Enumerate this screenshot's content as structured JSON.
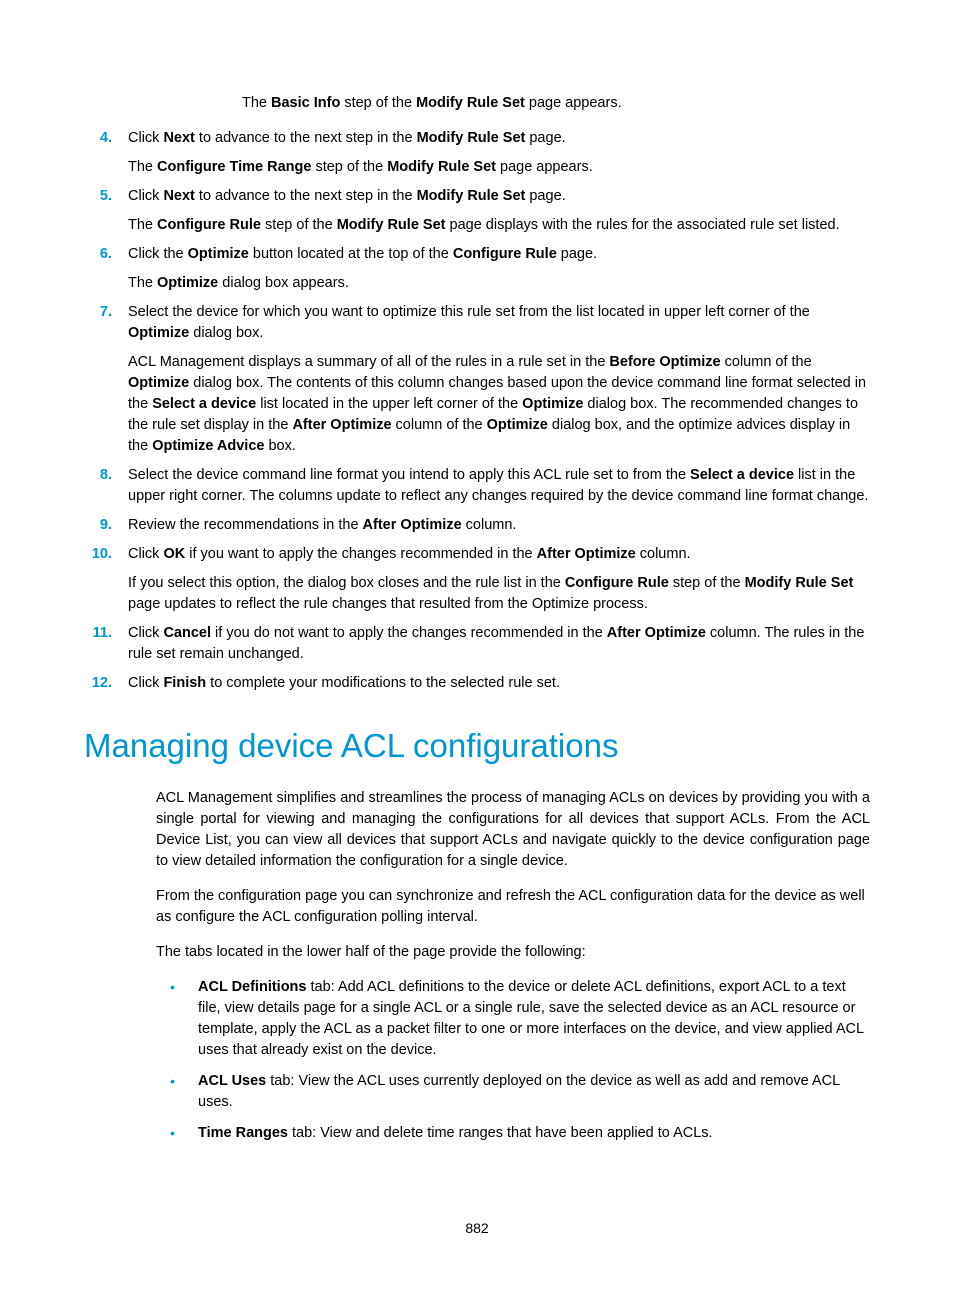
{
  "steps": {
    "s4pre": [
      {
        "t": "The "
      },
      {
        "t": "Basic Info",
        "b": true
      },
      {
        "t": " step of the "
      },
      {
        "t": "Modify Rule Set",
        "b": true
      },
      {
        "t": " page appears."
      }
    ],
    "s4_num": "4.",
    "s4_a": [
      {
        "t": "Click "
      },
      {
        "t": "Next",
        "b": true
      },
      {
        "t": " to advance to the next step in the "
      },
      {
        "t": "Modify Rule Set",
        "b": true
      },
      {
        "t": " page."
      }
    ],
    "s4_b": [
      {
        "t": "The "
      },
      {
        "t": "Configure Time Range",
        "b": true
      },
      {
        "t": " step of the "
      },
      {
        "t": "Modify Rule Set",
        "b": true
      },
      {
        "t": " page appears."
      }
    ],
    "s5_num": "5.",
    "s5_a": [
      {
        "t": "Click "
      },
      {
        "t": "Next",
        "b": true
      },
      {
        "t": " to advance to the next step in the "
      },
      {
        "t": "Modify Rule Set",
        "b": true
      },
      {
        "t": " page."
      }
    ],
    "s5_b": [
      {
        "t": "The "
      },
      {
        "t": "Configure Rule",
        "b": true
      },
      {
        "t": " step of the "
      },
      {
        "t": "Modify Rule Set",
        "b": true
      },
      {
        "t": " page displays with the rules for the associated rule set listed."
      }
    ],
    "s6_num": "6.",
    "s6_a": [
      {
        "t": "Click the "
      },
      {
        "t": "Optimize",
        "b": true
      },
      {
        "t": " button located at the top of the "
      },
      {
        "t": "Configure Rule",
        "b": true
      },
      {
        "t": " page."
      }
    ],
    "s6_b": [
      {
        "t": "The "
      },
      {
        "t": "Optimize",
        "b": true
      },
      {
        "t": " dialog box appears."
      }
    ],
    "s7_num": "7.",
    "s7_a": [
      {
        "t": "Select the device for which you want to optimize this rule set from the list located in upper left corner of the "
      },
      {
        "t": "Optimize",
        "b": true
      },
      {
        "t": " dialog box."
      }
    ],
    "s7_b": [
      {
        "t": "ACL Management displays a summary of all of the rules in a rule set in the "
      },
      {
        "t": "Before Optimize",
        "b": true
      },
      {
        "t": " column of the "
      },
      {
        "t": "Optimize",
        "b": true
      },
      {
        "t": " dialog box. The contents of this column changes based upon the device command line format selected in the "
      },
      {
        "t": "Select a device",
        "b": true
      },
      {
        "t": " list located in the upper left corner of the "
      },
      {
        "t": "Optimize",
        "b": true
      },
      {
        "t": " dialog box. The recommended changes to the rule set display in the "
      },
      {
        "t": "After Optimize",
        "b": true
      },
      {
        "t": " column of the "
      },
      {
        "t": "Optimize",
        "b": true
      },
      {
        "t": " dialog box, and the optimize advices display in the "
      },
      {
        "t": "Optimize Advice",
        "b": true
      },
      {
        "t": " box."
      }
    ],
    "s8_num": "8.",
    "s8_a": [
      {
        "t": "Select the device command line format you intend to apply this ACL rule set to from the "
      },
      {
        "t": "Select a device",
        "b": true
      },
      {
        "t": " list in the upper right corner. The columns update to reflect any changes required by the device command line format change."
      }
    ],
    "s9_num": "9.",
    "s9_a": [
      {
        "t": "Review the recommendations in the "
      },
      {
        "t": "After Optimize",
        "b": true
      },
      {
        "t": " column."
      }
    ],
    "s10_num": "10.",
    "s10_a": [
      {
        "t": "Click "
      },
      {
        "t": "OK",
        "b": true
      },
      {
        "t": " if you want to apply the changes recommended in the "
      },
      {
        "t": "After Optimize",
        "b": true
      },
      {
        "t": " column."
      }
    ],
    "s10_b": [
      {
        "t": "If you select this option, the dialog box closes and the rule list in the "
      },
      {
        "t": "Configure Rule",
        "b": true
      },
      {
        "t": " step of the "
      },
      {
        "t": "Modify Rule Set",
        "b": true
      },
      {
        "t": " page updates to reflect the rule changes that resulted from the Optimize process."
      }
    ],
    "s11_num": "11.",
    "s11_a": [
      {
        "t": "Click "
      },
      {
        "t": "Cancel",
        "b": true
      },
      {
        "t": " if you do not want to apply the changes recommended in the "
      },
      {
        "t": "After Optimize",
        "b": true
      },
      {
        "t": " column. The rules in the rule set remain unchanged."
      }
    ],
    "s12_num": "12.",
    "s12_a": [
      {
        "t": "Click "
      },
      {
        "t": "Finish",
        "b": true
      },
      {
        "t": " to complete your modifications to the selected rule set."
      }
    ]
  },
  "heading": "Managing device ACL configurations",
  "intro_p1": "ACL Management simplifies and streamlines the process of managing ACLs on devices by providing you with a single portal for viewing and managing the configurations for all devices that support ACLs. From the ACL Device List, you can view all devices that support ACLs and navigate quickly to the device configuration page to view detailed information the configuration for a single device.",
  "intro_p2": "From the configuration page you can synchronize and refresh the ACL configuration data for the device as well as configure the ACL configuration polling interval.",
  "intro_p3": "The tabs located in the lower half of the page provide the following:",
  "bullets": {
    "b1": [
      {
        "t": "ACL Definitions",
        "b": true
      },
      {
        "t": " tab: Add ACL definitions to the device or delete ACL definitions, export ACL to a text file, view details page for a single ACL or a single rule, save the selected device as an ACL resource or template, apply the ACL as a packet filter to one or more interfaces on the device, and view applied ACL uses that already exist on the device."
      }
    ],
    "b2": [
      {
        "t": "ACL Uses",
        "b": true
      },
      {
        "t": " tab: View the ACL uses currently deployed on the device as well as add and remove ACL uses."
      }
    ],
    "b3": [
      {
        "t": "Time Ranges",
        "b": true
      },
      {
        "t": " tab: View and delete time ranges that have been applied to ACLs."
      }
    ]
  },
  "page_number": "882"
}
